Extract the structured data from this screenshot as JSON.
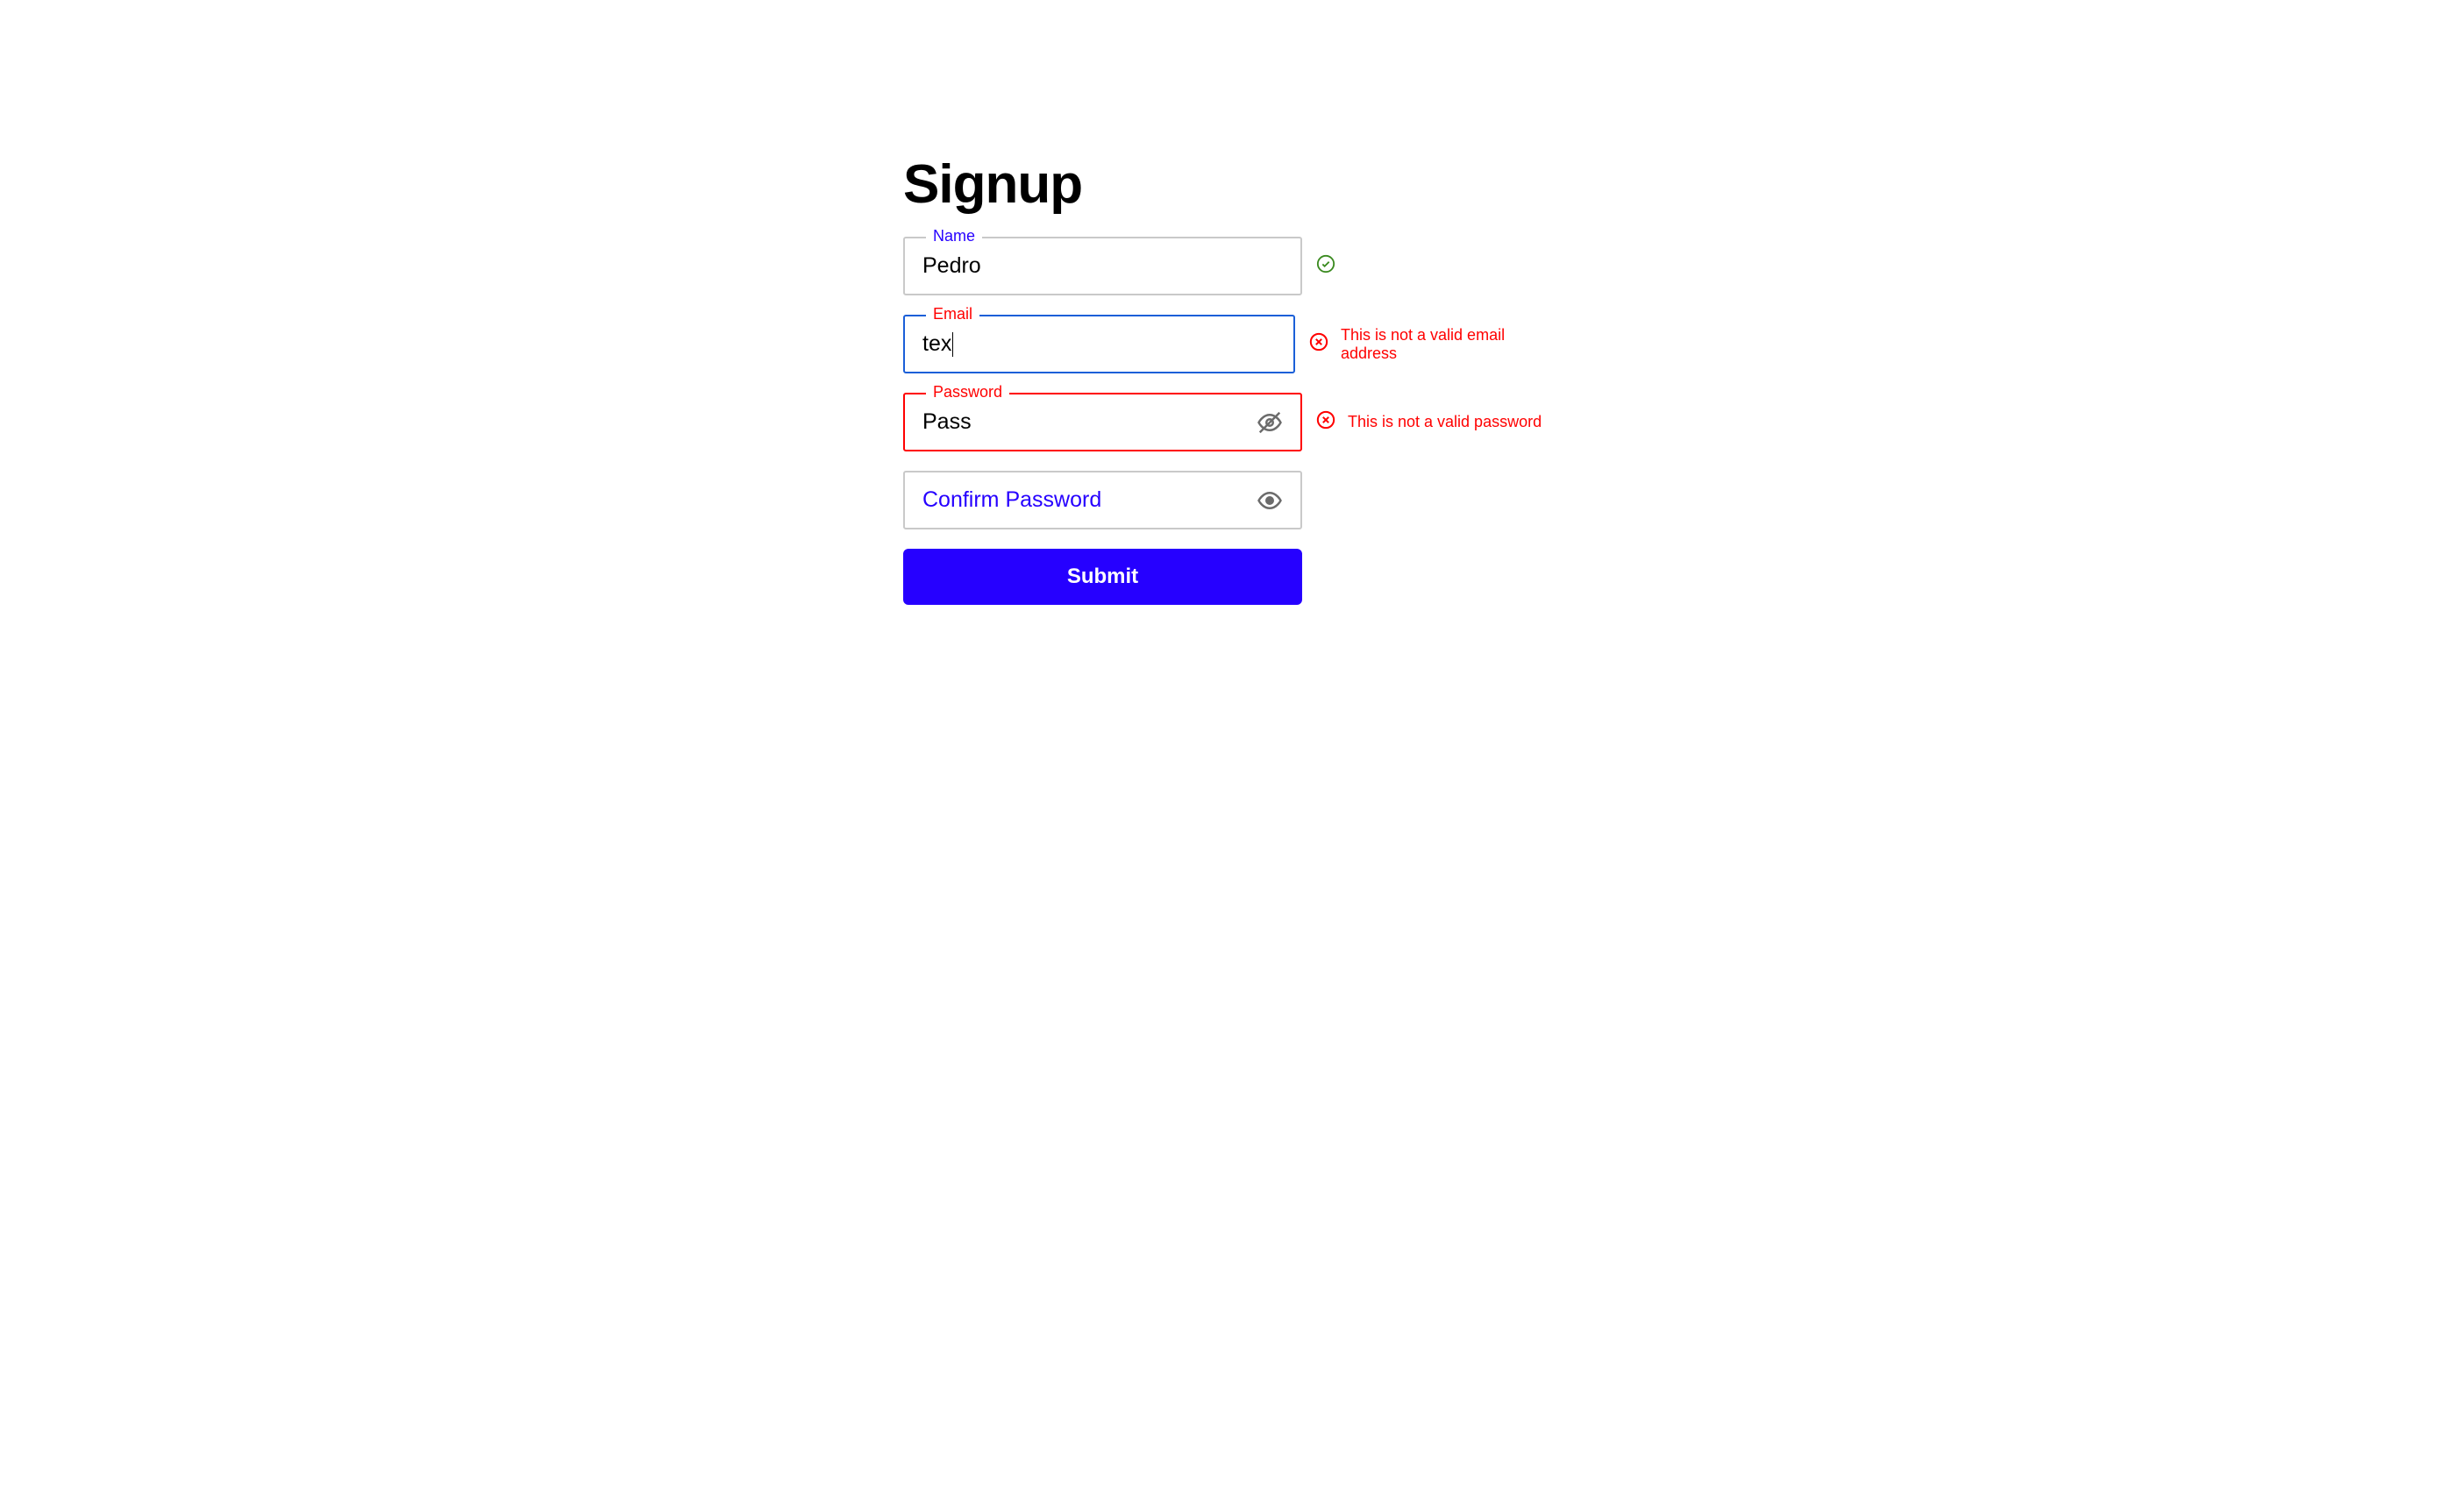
{
  "title": "Signup",
  "fields": {
    "name": {
      "label": "Name",
      "value": "Pedro"
    },
    "email": {
      "label": "Email",
      "value": "tex",
      "error": "This is not a valid email address"
    },
    "password": {
      "label": "Password",
      "value": "Pass",
      "error": "This is not a valid password"
    },
    "confirm": {
      "placeholder": "Confirm Password"
    }
  },
  "submit_label": "Submit"
}
